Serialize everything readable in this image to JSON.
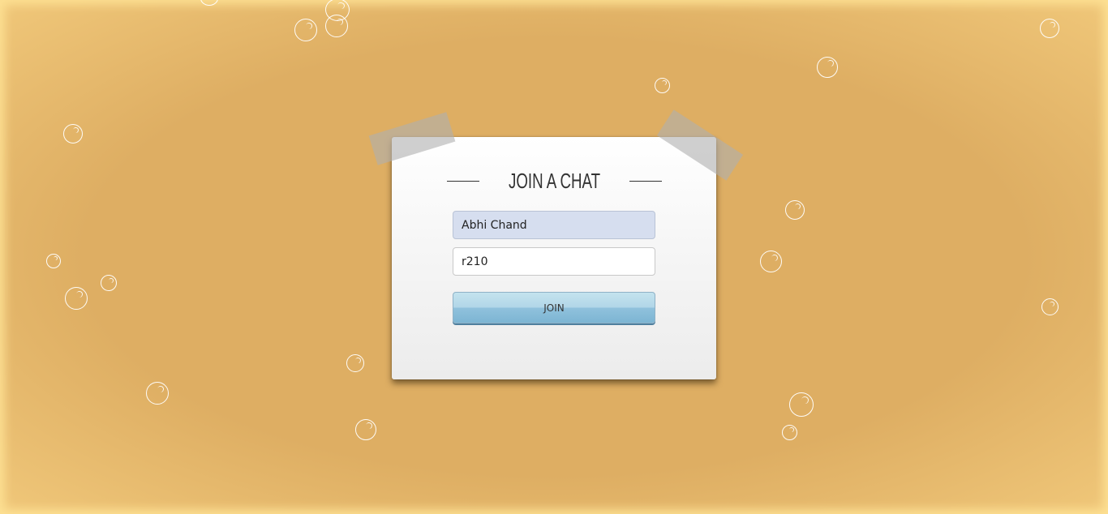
{
  "card": {
    "title": "JOIN A CHAT"
  },
  "form": {
    "name_value": "Abhi Chand",
    "room_value": "r210",
    "join_label": "JOIN"
  },
  "colors": {
    "background": "#deae63",
    "name_field_bg": "#d6deef",
    "join_button": "#8fc1dc"
  }
}
